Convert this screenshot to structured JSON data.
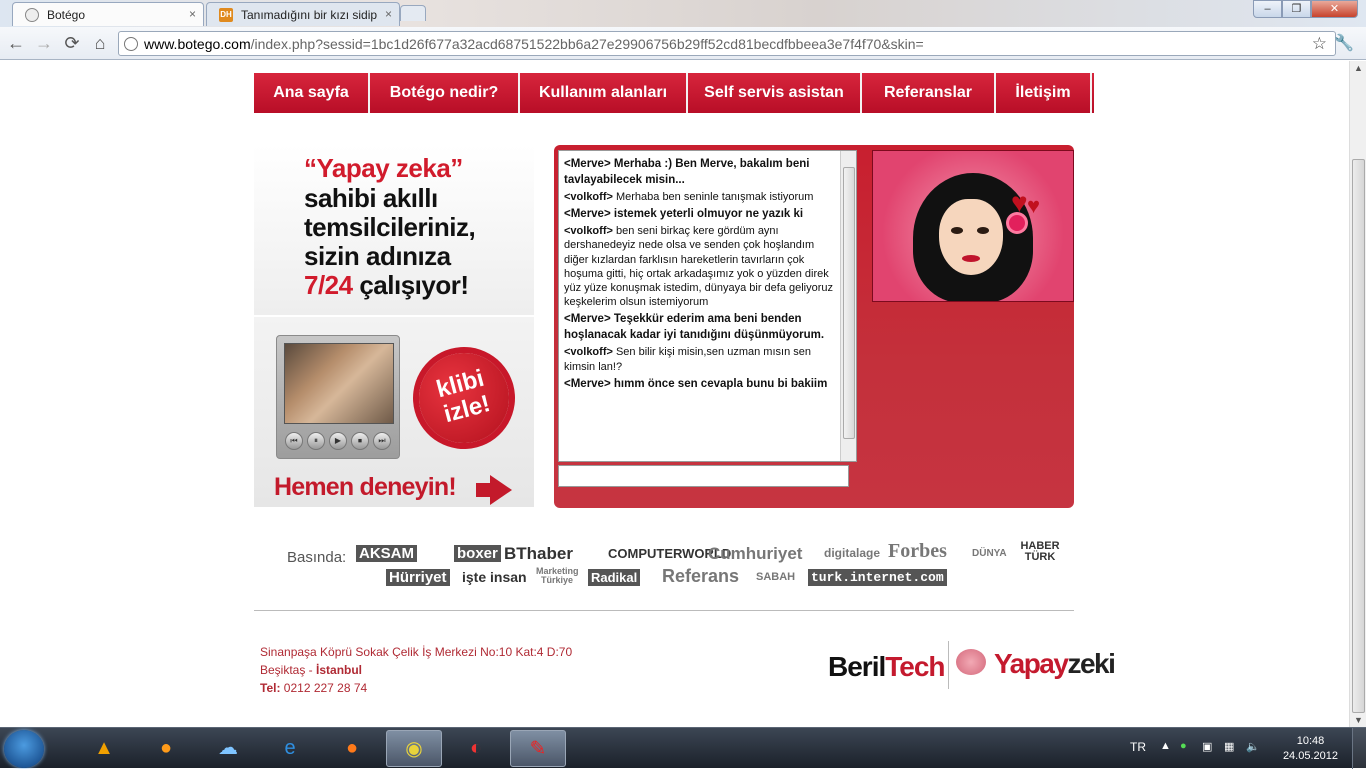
{
  "browser": {
    "tabs": [
      {
        "title": "Botégo",
        "icon": "globe-icon"
      },
      {
        "title": "Tanımadığını bir kızı sidip",
        "icon": "dh-icon"
      }
    ],
    "close_glyph": "×",
    "url_domain": "www.botego.com",
    "url_rest": "/index.php?sessid=1bc1d26f677a32acd68751522bb6a27e29906756b29ff52cd81becdfbbeea3e7f4f70&skin=",
    "nav_back": "←",
    "nav_forward": "→",
    "nav_reload": "⟳",
    "nav_home": "⌂",
    "star": "☆",
    "wrench": "🔧",
    "win_min": "–",
    "win_max": "❐",
    "win_close": "✕"
  },
  "site": {
    "nav": [
      "Ana sayfa",
      "Botégo nedir?",
      "Kullanım alanları",
      "Self servis asistan",
      "Referanslar",
      "İletişim"
    ],
    "promo": {
      "line1": "“Yapay zeka”",
      "line2": "sahibi akıllı",
      "line3": "temsilcileriniz,",
      "line4": "sizin adınıza",
      "line5_red": "7/24",
      "line5_rest": "çalışıyor!"
    },
    "video": {
      "badge_line1": "klibi",
      "badge_line2": "izle!",
      "cta": "Hemen deneyin!",
      "controls": [
        "⏮",
        "⏸",
        "▶",
        "⏹",
        "⏭"
      ]
    },
    "chat": {
      "messages": [
        {
          "who": "<Merve>",
          "text": "Merhaba :) Ben Merve, bakalım beni tavlayabilecek misin...",
          "bot": true
        },
        {
          "who": "<volkoff>",
          "text": "Merhaba ben seninle tanışmak istiyorum",
          "bot": false
        },
        {
          "who": "<Merve>",
          "text": "istemek yeterli olmuyor ne yazık ki",
          "bot": true
        },
        {
          "who": "<volkoff>",
          "text": "ben seni birkaç kere gördüm aynı dershanedeyiz nede olsa ve senden çok hoşlandım diğer kızlardan farklısın hareketlerin tavırların çok hoşuma gitti, hiç ortak arkadaşımız yok o yüzden direk yüz yüze konuşmak istedim, dünyaya bir defa geliyoruz keşkelerim olsun istemiyorum",
          "bot": false
        },
        {
          "who": "<Merve>",
          "text": "Teşekkür ederim ama beni benden hoşlanacak kadar iyi tanıdığını düşünmüyorum.",
          "bot": true
        },
        {
          "who": "<volkoff>",
          "text": "Sen bilir kişi misin,sen uzman mısın sen kimsin lan!?",
          "bot": false
        },
        {
          "who": "<Merve>",
          "text": "hımm önce sen cevapla bunu bi bakiim",
          "bot": true
        }
      ],
      "input_value": ""
    },
    "press": {
      "label": "Basında:",
      "logos": [
        "AKSAM",
        "boxer",
        "BThaber",
        "COMPUTERWORLD",
        "Cumhuriyet",
        "digitalage",
        "Forbes",
        "DÜNYA",
        "HABER TÜRK",
        "Hürriyet",
        "işte insan",
        "Marketing Türkiye",
        "Radikal",
        "Referans",
        "SABAH",
        "turk.internet.com"
      ]
    },
    "footer": {
      "address1": "Sinanpaşa Köprü Sokak Çelik İş Merkezi No:10 Kat:4 D:70",
      "address2_a": "Beşiktaş - ",
      "address2_b": "İstanbul",
      "phone_label": "Tel:",
      "phone": "0212 227 28 74",
      "brand_a": "Beril",
      "brand_b": "Tech",
      "brand2_a": "Yapay",
      "brand2_b": "zeki"
    }
  },
  "taskbar": {
    "lang": "TR",
    "time": "10:48",
    "date": "24.05.2012",
    "apps": [
      "avast-icon",
      "messenger-icon",
      "network-icon",
      "ie-icon",
      "firefox-icon",
      "chrome-icon",
      "media-icon",
      "acrobat-icon"
    ]
  }
}
